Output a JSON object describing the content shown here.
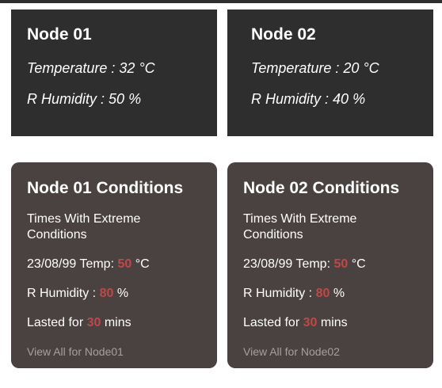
{
  "nodes": [
    {
      "title": "Node 01",
      "temperature_label": "Temperature : ",
      "temperature_value": "32",
      "temperature_unit": " °C",
      "humidity_label": "R Humidity : ",
      "humidity_value": "50",
      "humidity_unit": " %"
    },
    {
      "title": "Node 02",
      "temperature_label": "Temperature : ",
      "temperature_value": "20",
      "temperature_unit": " °C",
      "humidity_label": "R Humidity : ",
      "humidity_value": "40",
      "humidity_unit": " %"
    }
  ],
  "conditions": [
    {
      "title": "Node 01 Conditions",
      "subtitle": "Times With Extreme Conditions",
      "date_temp_label": "23/08/99 Temp: ",
      "temp_value": "50",
      "temp_unit": " °C",
      "humidity_label": "R Humidity : ",
      "humidity_value": "80",
      "humidity_unit": " %",
      "lasted_label": "Lasted for ",
      "lasted_value": "30",
      "lasted_unit": " mins",
      "view_all": "View All for Node01"
    },
    {
      "title": "Node 02 Conditions",
      "subtitle": "Times With Extreme Conditions",
      "date_temp_label": "23/08/99 Temp: ",
      "temp_value": "50",
      "temp_unit": " °C",
      "humidity_label": "R Humidity : ",
      "humidity_value": "80",
      "humidity_unit": " %",
      "lasted_label": "Lasted for ",
      "lasted_value": "30",
      "lasted_unit": " mins",
      "view_all": "View All for Node02"
    }
  ],
  "colors": {
    "node_card_bg": "#2e2e2e",
    "condition_card_bg": "#4a4141",
    "highlight": "#c04848",
    "link_muted": "#a89f9f"
  }
}
